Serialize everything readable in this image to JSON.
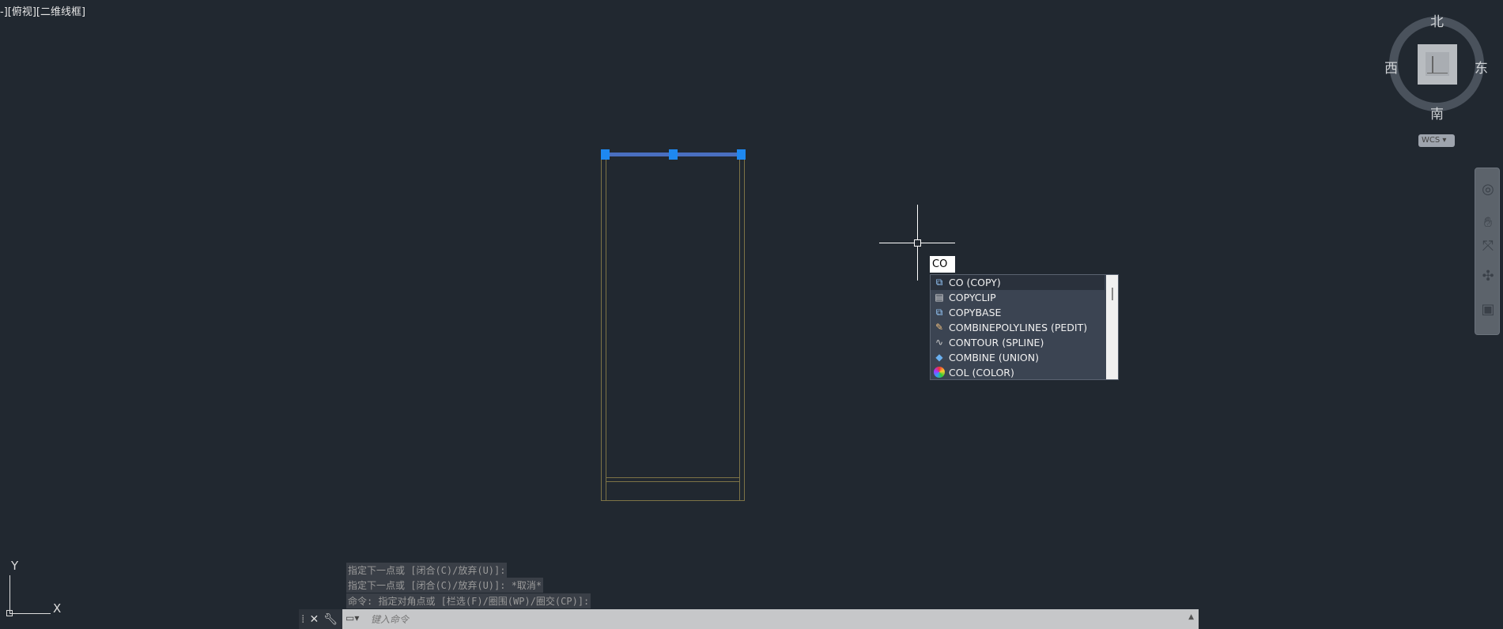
{
  "viewport": {
    "label": "-][俯视][二维线框]"
  },
  "command_input": {
    "value": "CO"
  },
  "autocomplete": {
    "items": [
      {
        "label": "CO (COPY)",
        "icon": "copy-icon"
      },
      {
        "label": "COPYCLIP",
        "icon": "copyclip-icon"
      },
      {
        "label": "COPYBASE",
        "icon": "copybase-icon"
      },
      {
        "label": "COMBINEPOLYLINES (PEDIT)",
        "icon": "pedit-icon"
      },
      {
        "label": "CONTOUR (SPLINE)",
        "icon": "spline-icon"
      },
      {
        "label": "COMBINE (UNION)",
        "icon": "union-icon"
      },
      {
        "label": "COL (COLOR)",
        "icon": "color-wheel-icon"
      }
    ]
  },
  "history": [
    "指定下一点或 [闭合(C)/放弃(U)]:",
    "指定下一点或 [闭合(C)/放弃(U)]: *取消*",
    "命令: 指定对角点或 [栏选(F)/圈围(WP)/圈交(CP)]:"
  ],
  "command_line": {
    "placeholder": "键入命令"
  },
  "viewcube": {
    "north": "北",
    "south": "南",
    "east": "东",
    "west": "西",
    "wcs": "WCS"
  },
  "ucs": {
    "x": "X",
    "y": "Y"
  },
  "colors": {
    "background": "#212830",
    "geometry": "#7d7346",
    "grip": "#1e88f0"
  }
}
